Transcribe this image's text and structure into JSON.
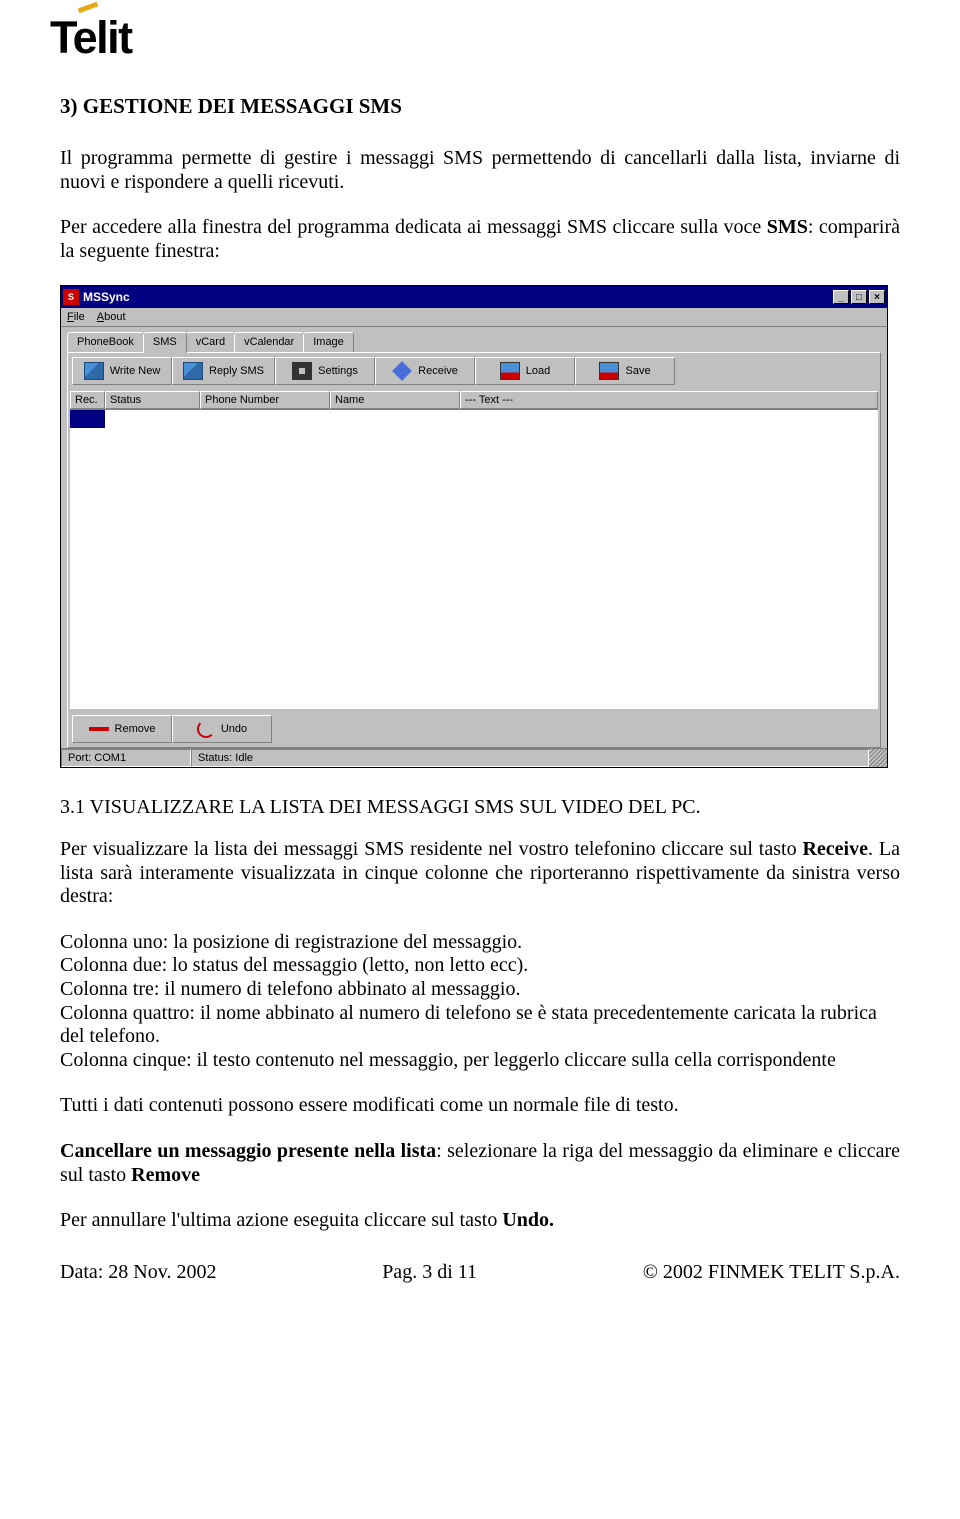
{
  "logo_text": "Telit",
  "heading": "3) GESTIONE DEI MESSAGGI SMS",
  "p1": "Il programma permette di gestire i messaggi SMS permettendo di cancellarli dalla lista, inviarne di nuovi e rispondere a quelli ricevuti.",
  "p2a": "Per accedere alla finestra del programma dedicata ai messaggi SMS cliccare sulla voce ",
  "p2b": "SMS",
  "p2c": ": comparirà la seguente finestra:",
  "section_title": "3.1 VISUALIZZARE LA LISTA DEI MESSAGGI SMS SUL VIDEO DEL PC.",
  "p3a": "Per visualizzare la lista dei messaggi SMS residente nel vostro telefonino cliccare sul tasto ",
  "p3b": "Receive",
  "p3c": ". La lista sarà interamente visualizzata in cinque colonne che riporteranno rispettivamente da sinistra verso destra:",
  "c1": "Colonna uno: la posizione di registrazione del messaggio.",
  "c2": "Colonna due: lo status del messaggio (letto, non letto ecc).",
  "c3": "Colonna tre: il numero di telefono abbinato al messaggio.",
  "c4": "Colonna quattro: il nome abbinato al numero di telefono se è stata precedentemente caricata la rubrica del telefono.",
  "c5": "Colonna cinque: il testo contenuto nel messaggio, per leggerlo cliccare sulla cella corrispondente",
  "p4": "Tutti i dati contenuti possono essere modificati come un normale file di testo.",
  "p5a": "Cancellare un messaggio presente nella lista",
  "p5b": ": selezionare la riga del messaggio da eliminare e cliccare sul tasto ",
  "p5c": "Remove",
  "p6a": "Per annullare l'ultima azione eseguita cliccare sul tasto ",
  "p6b": "Undo.",
  "footer": {
    "left": "Data: 28 Nov. 2002",
    "center": "Pag. 3 di 11",
    "right": "© 2002 FINMEK TELIT S.p.A."
  },
  "win": {
    "title": "MSSync",
    "menu": {
      "file": "File",
      "about": "About"
    },
    "tabs": [
      "PhoneBook",
      "SMS",
      "vCard",
      "vCalendar",
      "Image"
    ],
    "toolbar": {
      "write": "Write New",
      "reply": "Reply SMS",
      "settings": "Settings",
      "receive": "Receive",
      "load": "Load",
      "save": "Save"
    },
    "cols": {
      "rec": "Rec.",
      "status": "Status",
      "phone": "Phone Number",
      "name": "Name",
      "text": "--- Text ---"
    },
    "bottom": {
      "remove": "Remove",
      "undo": "Undo"
    },
    "status": {
      "port": "Port: COM1",
      "idle": "Status: Idle"
    }
  }
}
